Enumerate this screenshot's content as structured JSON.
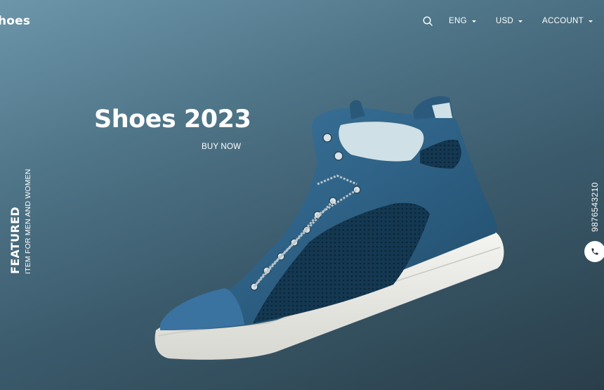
{
  "brand": {
    "name": "hoes"
  },
  "nav": {
    "search_icon": "search-icon",
    "language": "ENG",
    "currency": "USD",
    "account": "ACCOUNT"
  },
  "hero": {
    "title": "Shoes 2023",
    "cta": "BUY NOW"
  },
  "side_left": {
    "title": "FEATURED",
    "subtitle": "ITEM FOR MEN AND WOMEN"
  },
  "side_right": {
    "phone": "9876543210",
    "phone_icon": "phone-icon"
  },
  "colors": {
    "background_light": "#6d96aa",
    "background_dark": "#2a3e4a",
    "shoe_blue": "#2f6184",
    "sole": "#e8e8e4",
    "text": "#ffffff"
  }
}
